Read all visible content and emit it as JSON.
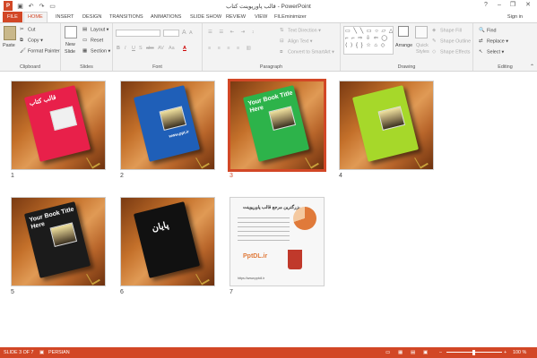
{
  "window": {
    "title": "قالب پاورپوینت کتاب - PowerPoint",
    "help": "?",
    "minimize": "–",
    "restore": "❐",
    "close": "✕"
  },
  "quick_access": [
    "save-icon",
    "undo-icon",
    "redo-icon",
    "present-icon"
  ],
  "tabs": [
    "FILE",
    "HOME",
    "INSERT",
    "DESIGN",
    "TRANSITIONS",
    "ANIMATIONS",
    "SLIDE SHOW",
    "REVIEW",
    "VIEW",
    "FILEminimizer"
  ],
  "active_tab": "HOME",
  "sign_in": "Sign in",
  "ribbon": {
    "clipboard": {
      "paste": "Paste",
      "cut": "Cut",
      "copy": "Copy",
      "format_painter": "Format Painter",
      "label": "Clipboard"
    },
    "slides": {
      "new_slide": "New",
      "new_slide2": "Slide",
      "layout": "Layout",
      "reset": "Reset",
      "section": "Section",
      "label": "Slides"
    },
    "font": {
      "label": "Font",
      "bold": "B",
      "italic": "I",
      "underline": "U",
      "shadow": "S",
      "strike": "abc",
      "spacing": "AV",
      "case": "Aa",
      "color": "A",
      "grow": "A",
      "shrink": "A",
      "clear": "A"
    },
    "paragraph": {
      "text_direction": "Text Direction",
      "align_text": "Align Text",
      "smartart": "Convert to SmartArt",
      "label": "Paragraph"
    },
    "drawing": {
      "arrange": "Arrange",
      "quick_styles": "Quick",
      "quick_styles2": "Styles",
      "shape_fill": "Shape Fill",
      "shape_outline": "Shape Outline",
      "shape_effects": "Shape Effects",
      "label": "Drawing"
    },
    "editing": {
      "find": "Find",
      "replace": "Replace",
      "select": "Select",
      "label": "Editing"
    }
  },
  "slides": [
    {
      "num": "1",
      "color": "#e8204a",
      "text": "قالب کتاب",
      "selected": false
    },
    {
      "num": "2",
      "color": "#1f5fb8",
      "text": "www.ppt.ir",
      "selected": false
    },
    {
      "num": "3",
      "color": "#2db34a",
      "text": "Your Book Title Here",
      "selected": true
    },
    {
      "num": "4",
      "color": "#a6d82a",
      "text": "",
      "selected": false
    },
    {
      "num": "5",
      "color": "#1b1b1b",
      "text": "Your Book Title Here",
      "selected": false
    },
    {
      "num": "6",
      "color": "#111111",
      "text": "پایان",
      "selected": false
    },
    {
      "num": "7",
      "color": "#ffffff",
      "text": "",
      "selected": false
    }
  ],
  "ad_slide": {
    "heading": "بزرگترین مرجع قالب پاورپوینت",
    "logo": "PptDL.ir",
    "url": "https://www.pptdl.ir"
  },
  "status": {
    "slide": "SLIDE 3 OF 7",
    "lang": "PERSIAN",
    "zoom": "100 %",
    "notes": "NOTES",
    "comments": "COMMENTS"
  },
  "colors": {
    "accent": "#d24726",
    "ribbon": "#f3f3f3"
  }
}
